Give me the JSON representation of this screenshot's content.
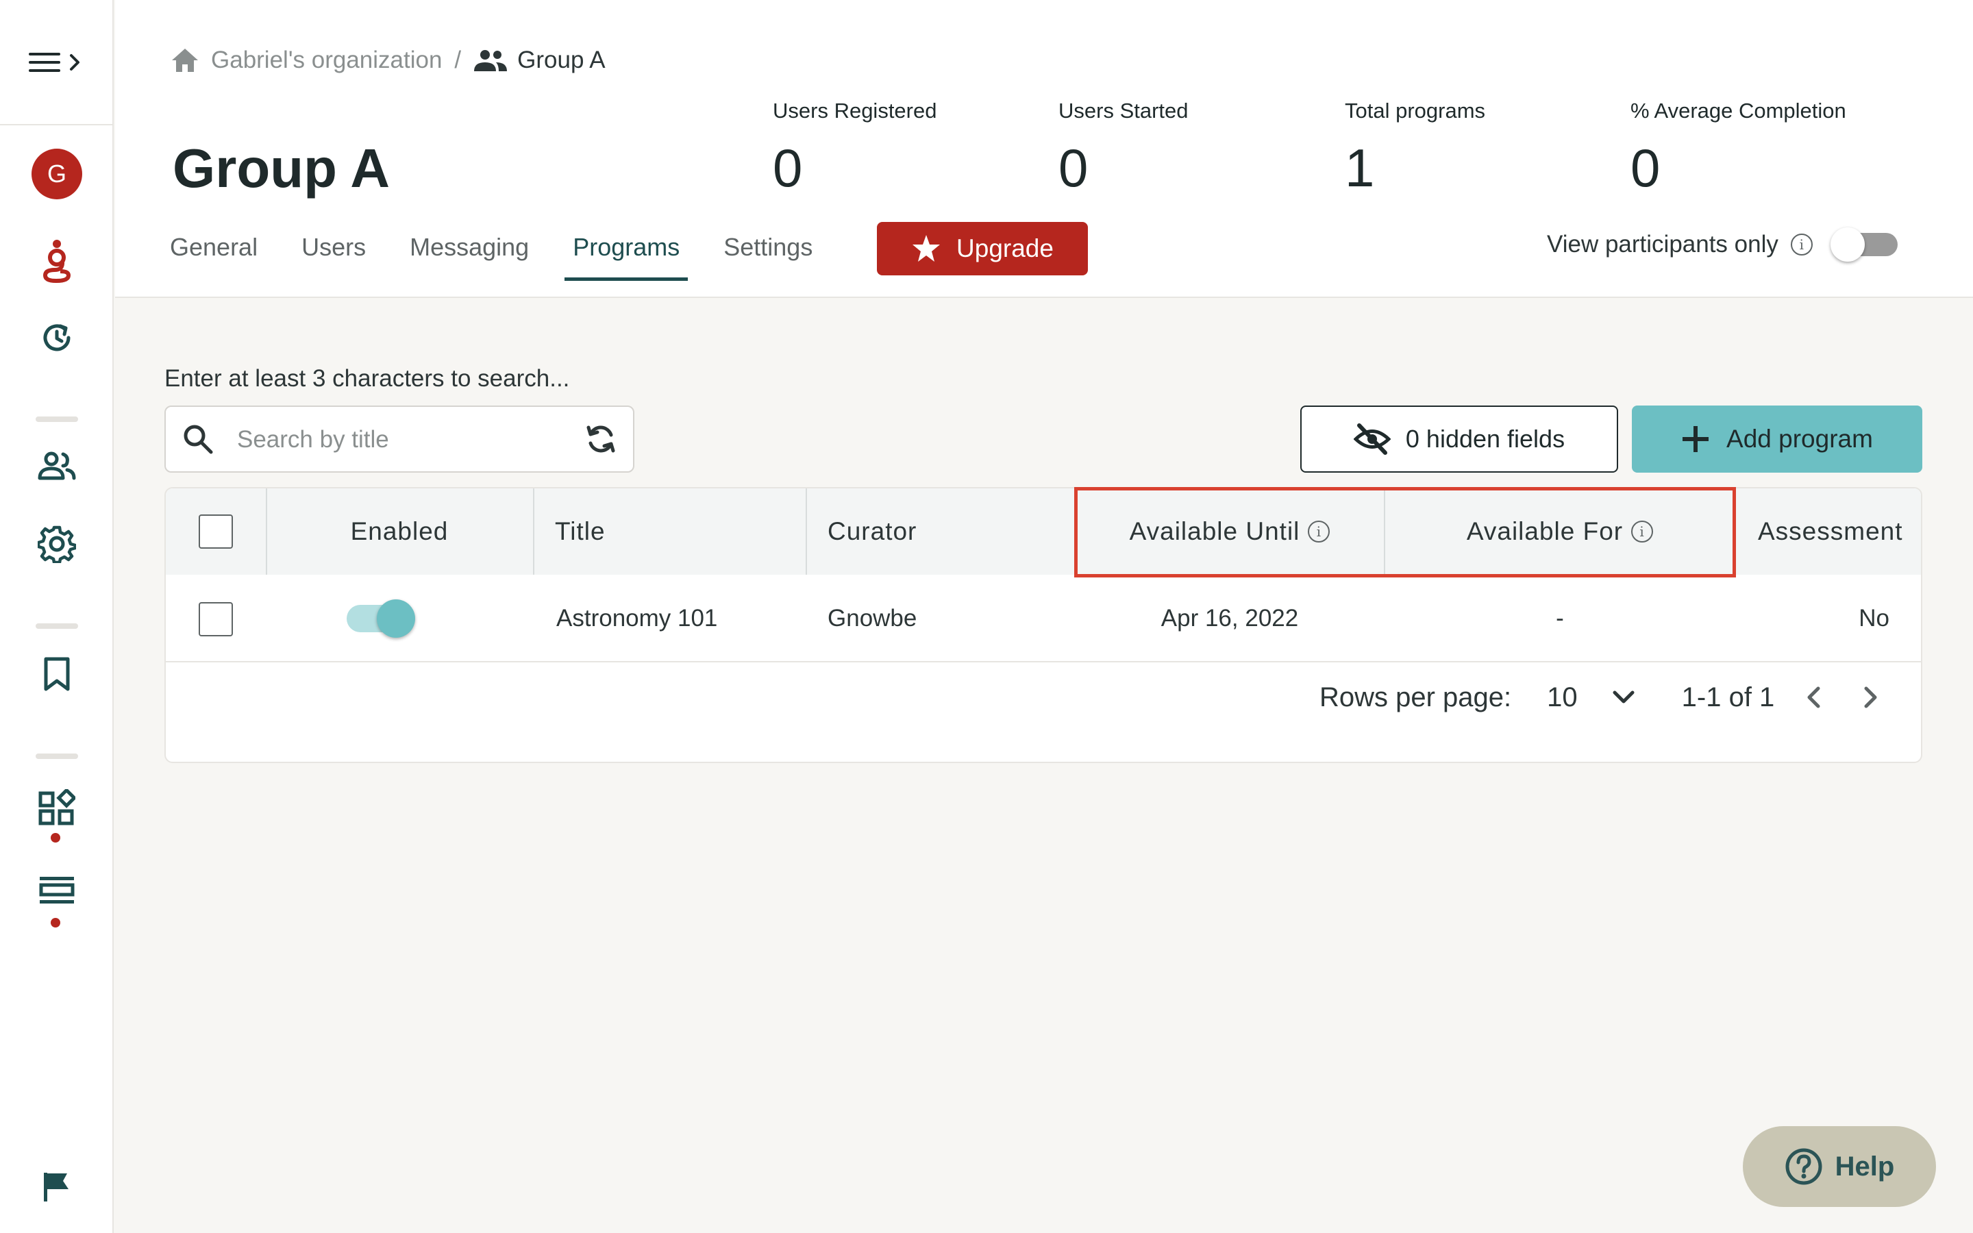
{
  "breadcrumb": {
    "home_label": "Gabriel's organization",
    "separator": "/",
    "current_label": "Group A"
  },
  "page_title": "Group A",
  "stats": [
    {
      "label": "Users Registered",
      "value": "0"
    },
    {
      "label": "Users Started",
      "value": "0"
    },
    {
      "label": "Total programs",
      "value": "1"
    },
    {
      "label": "% Average Completion",
      "value": "0"
    }
  ],
  "tabs": [
    {
      "label": "General"
    },
    {
      "label": "Users"
    },
    {
      "label": "Messaging"
    },
    {
      "label": "Programs",
      "active": true
    },
    {
      "label": "Settings"
    }
  ],
  "upgrade_label": "Upgrade",
  "view_participants": {
    "label": "View participants only",
    "enabled": false
  },
  "sidebar": {
    "avatar_letter": "G"
  },
  "search": {
    "hint": "Enter at least 3 characters to search...",
    "placeholder": "Search by title"
  },
  "toolbar": {
    "hidden_fields_label": "0 hidden fields",
    "add_program_label": "Add program"
  },
  "table": {
    "columns": [
      "Enabled",
      "Title",
      "Curator",
      "Available Until",
      "Available For",
      "Assessment"
    ],
    "rows": [
      {
        "enabled": true,
        "title": "Astronomy 101",
        "curator": "Gnowbe",
        "available_until": "Apr 16, 2022",
        "available_for": "-",
        "assessment": "No"
      }
    ]
  },
  "pagination": {
    "rows_per_page_label": "Rows per page:",
    "rows_per_page_value": "10",
    "range_label": "1-1 of 1"
  },
  "help_label": "Help",
  "colors": {
    "brand_red": "#b5261e",
    "accent_teal": "#6cbfc3",
    "dark_teal": "#1e4d4f",
    "highlight_red": "#d9412f"
  }
}
